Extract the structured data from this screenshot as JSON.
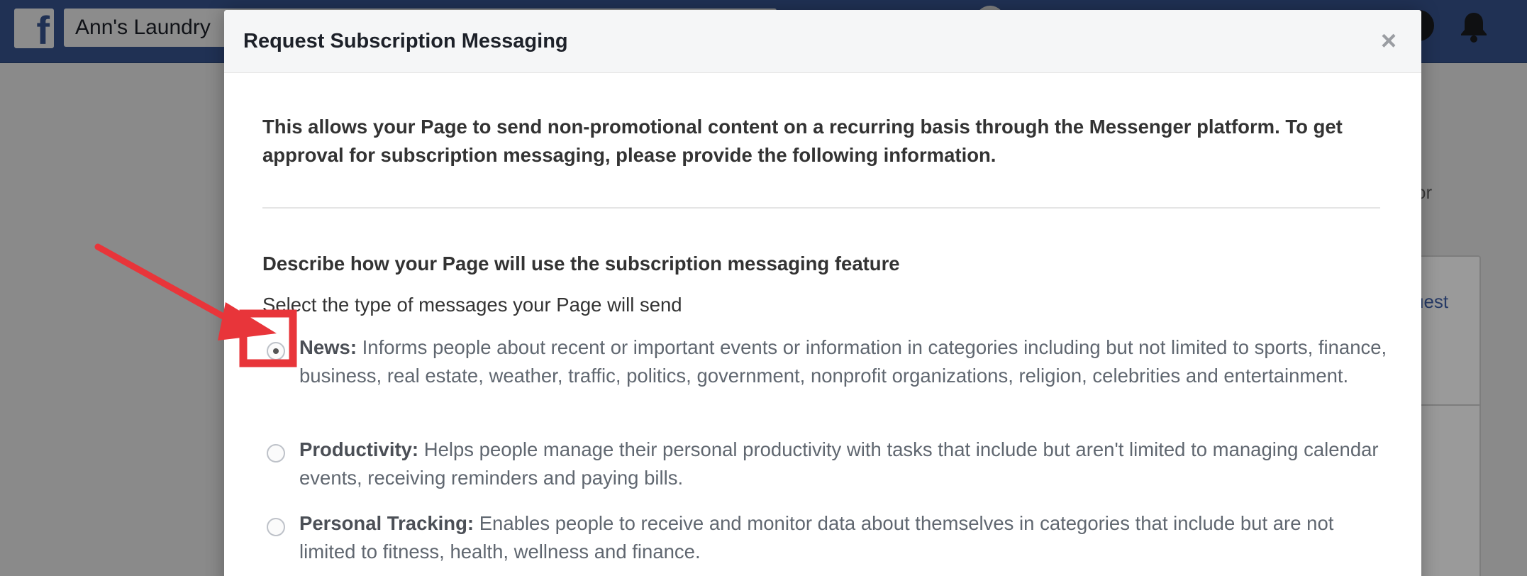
{
  "topbar": {
    "logo_icon": "facebook-f-icon",
    "search_value": "Ann's Laundry",
    "bell_icon": "notifications-bell-icon"
  },
  "background": {
    "partial_text_or": "or",
    "partial_link_uest": "uest"
  },
  "modal": {
    "title": "Request Subscription Messaging",
    "close_label": "×",
    "intro": "This allows your Page to send non-promotional content on a recurring basis through the Messenger platform. To get approval for subscription messaging, please provide the following information.",
    "section_heading": "Describe how your Page will use the subscription messaging feature",
    "section_subheading": "Select the type of messages your Page will send",
    "options": [
      {
        "label": "News:",
        "description": "Informs people about recent or important events or information in categories including but not limited to sports, finance, business, real estate, weather, traffic, politics, government, nonprofit organizations, religion, celebrities and entertainment.",
        "selected": true
      },
      {
        "label": "Productivity:",
        "description": "Helps people manage their personal productivity with tasks that include but aren't limited to managing calendar events, receiving reminders and paying bills.",
        "selected": false
      },
      {
        "label": "Personal Tracking:",
        "description": "Enables people to receive and monitor data about themselves in categories that include but are not limited to fitness, health, wellness and finance.",
        "selected": false
      }
    ]
  },
  "colors": {
    "facebook_blue": "#3b5998",
    "annotation_red": "#e8353a",
    "overlay_gray": "#8a8a8a"
  }
}
